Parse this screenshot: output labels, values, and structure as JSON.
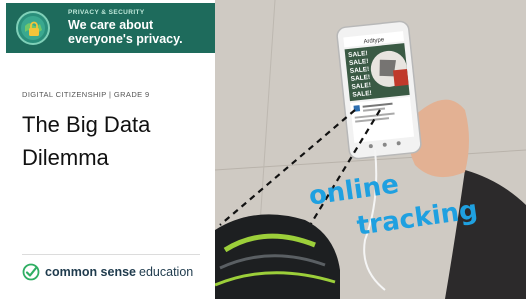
{
  "banner": {
    "kicker": "PRIVACY & SECURITY",
    "title": "We care about everyone's privacy."
  },
  "lesson": {
    "eyebrow": "DIGITAL CITIZENSHIP | GRADE 9",
    "title": "The Big Data Dilemma"
  },
  "brand": {
    "name": "common sense",
    "product": "education"
  },
  "photo": {
    "phone_header": "Ardtype",
    "sale_labels": [
      "SALE!",
      "SALE!",
      "SALE!",
      "SALE!",
      "SALE!",
      "SALE!"
    ],
    "overlay_line1": "online",
    "overlay_line2": "tracking"
  },
  "colors": {
    "banner": "#1e6b5c",
    "overlay_text": "#1fa0e0",
    "brand_text": "#1f3b4d",
    "brand_check": "#2fae63"
  }
}
